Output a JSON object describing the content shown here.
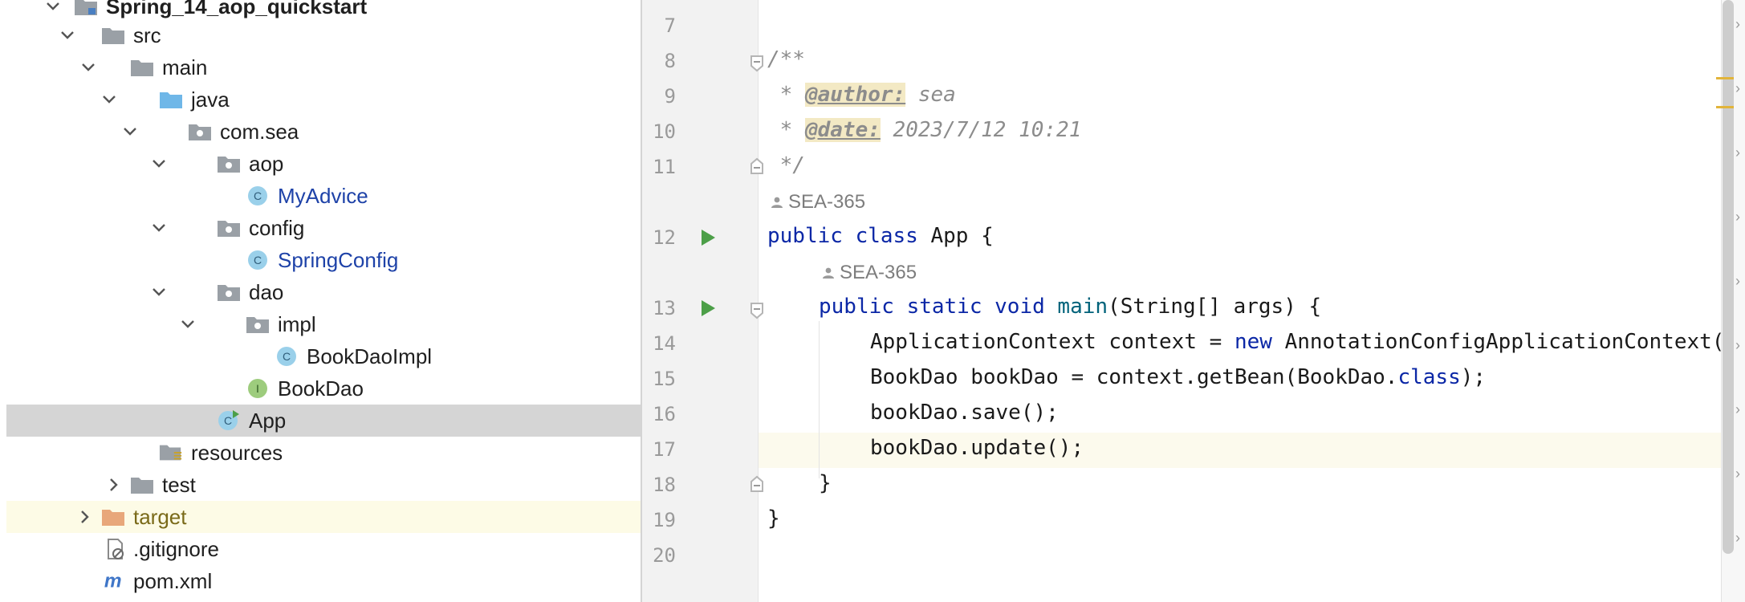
{
  "tree": {
    "project": "Spring_14_aop_quickstart",
    "src": "src",
    "main": "main",
    "java": "java",
    "package": "com.sea",
    "aop": "aop",
    "my_advice": "MyAdvice",
    "config": "config",
    "spring_config": "SpringConfig",
    "dao": "dao",
    "impl": "impl",
    "book_dao_impl": "BookDaoImpl",
    "book_dao": "BookDao",
    "app": "App",
    "resources": "resources",
    "test": "test",
    "target": "target",
    "gitignore": ".gitignore",
    "pom": "pom.xml",
    "class_badge": "C",
    "interface_badge": "I",
    "maven_badge": "m"
  },
  "editor": {
    "line_numbers": [
      "7",
      "8",
      "9",
      "10",
      "11",
      "12",
      "13",
      "14",
      "15",
      "16",
      "17",
      "18",
      "19",
      "20"
    ],
    "comment_open": "/**",
    "author_prefix": " * ",
    "author_tag": "@author:",
    "author_value": " sea",
    "date_prefix": " * ",
    "date_tag": "@date:",
    "date_value": " 2023/7/12 10:21",
    "comment_close": " */",
    "vcs_author": "SEA-365",
    "code": {
      "l12_kw": "public class",
      "l12_rest": " App {",
      "l13_kw": "public static void",
      "l13_fn": " main",
      "l13_rest": "(String[] args) {",
      "l14_a": "ApplicationContext context = ",
      "l14_kw": "new",
      "l14_b": " AnnotationConfigApplicationContext(",
      "l15_a": "BookDao bookDao = context.getBean(BookDao.",
      "l15_kw": "class",
      "l15_b": ");",
      "l16": "bookDao.save();",
      "l17": "bookDao.update();",
      "l18": "}",
      "l19": "}"
    }
  },
  "colors": {
    "folder": "#9aa0a6",
    "source_folder": "#6fb7e8",
    "excluded_folder": "#e8a77a",
    "class_icon": "#9ad0ea",
    "interface_icon": "#9dcc7d",
    "run_icon": "#4c9f48",
    "accent": "#e2b43a"
  }
}
